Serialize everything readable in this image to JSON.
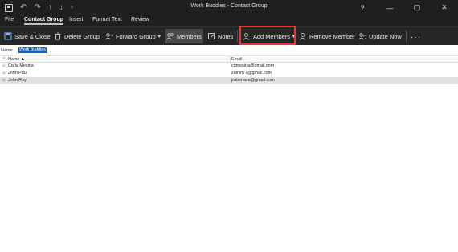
{
  "window": {
    "title": "Work Buddies  -  Contact Group"
  },
  "quick_access": [
    "save-icon",
    "undo-icon",
    "redo-icon",
    "up-icon",
    "down-icon",
    "customize-icon"
  ],
  "window_controls": {
    "help": "?",
    "minimize": "—",
    "restore": "▢",
    "close": "✕"
  },
  "tabs": [
    "File",
    "Contact Group",
    "Insert",
    "Format Text",
    "Review"
  ],
  "active_tab": "Contact Group",
  "ribbon": {
    "save_close": "Save & Close",
    "delete_group": "Delete Group",
    "forward_group": "Forward Group",
    "members": "Members",
    "notes": "Notes",
    "add_members": "Add Members",
    "remove_member": "Remove Member",
    "update_now": "Update Now",
    "more": "···"
  },
  "name_bar": {
    "label": "Name",
    "value": "Work Buddies"
  },
  "table": {
    "columns": [
      "Name ▲",
      "Email"
    ],
    "rows": [
      {
        "name": "Carla Mesina",
        "email": "cgmesina@gmail.com",
        "selected": false
      },
      {
        "name": "John Paul",
        "email": "zainin77@gmail.com",
        "selected": false
      },
      {
        "name": "John Roy",
        "email": "jrabenaza@gmail.com",
        "selected": true
      }
    ]
  },
  "colors": {
    "titlebar": "#1f1f1f",
    "ribbon": "#262626",
    "accent": "#0a64c8",
    "highlight": "#e53935"
  }
}
